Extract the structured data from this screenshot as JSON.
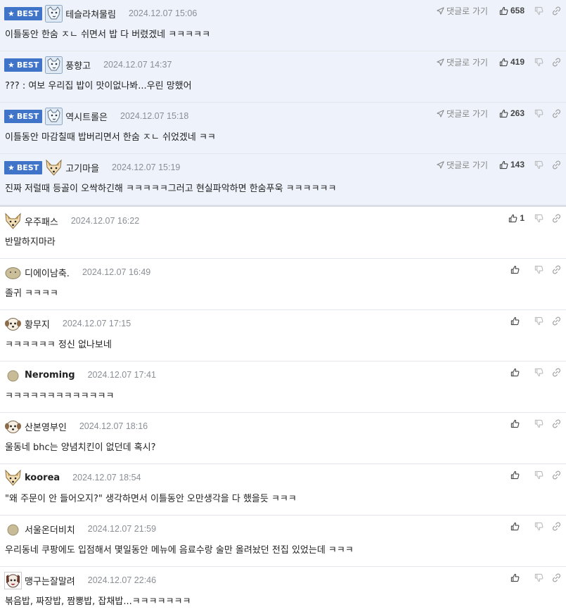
{
  "labels": {
    "best": "BEST",
    "reply": "댓글로 가기"
  },
  "colors": {
    "best_bg": "#eef3fb",
    "badge_bg": "#3f74c9",
    "date": "#8a8f96"
  },
  "comments": [
    {
      "best": true,
      "avatar": "wolf-avatar",
      "nick": "테슬라쳐물림",
      "date": "2024.12.07 15:06",
      "likes": "658",
      "text": "이틀동안 한숨 ㅈㄴ 쉬면서 밥 다 버렸겠네 ㅋㅋㅋㅋㅋ"
    },
    {
      "best": true,
      "avatar": "wolf-avatar",
      "nick": "풍향고",
      "date": "2024.12.07 14:37",
      "likes": "419",
      "text": "??? : 여보 우리집 밥이 맛이없나봐...우린 망했어"
    },
    {
      "best": true,
      "avatar": "wolf-avatar",
      "nick": "역시트롤은",
      "date": "2024.12.07 15:18",
      "likes": "263",
      "text": "이틀동안 마감칠때 밥버리면서 한숨 ㅈㄴ 쉬었겠네 ㅋㅋ"
    },
    {
      "best": true,
      "avatar": "fox-avatar",
      "nick": "고기마을",
      "date": "2024.12.07 15:19",
      "likes": "143",
      "text": "진짜 저럴때 등골이 오싹하긴해 ㅋㅋㅋㅋㅋ그러고 현실파악하면 한숨푸욱 ㅋㅋㅋㅋㅋㅋ"
    },
    {
      "best": false,
      "avatar": "fox-avatar",
      "nick": "우주패스",
      "date": "2024.12.07 16:22",
      "likes": "1",
      "text": "반말하지마라"
    },
    {
      "best": false,
      "avatar": "potato-avatar",
      "nick": "디에이남축.",
      "date": "2024.12.07 16:49",
      "likes": "",
      "text": "졸귀 ㅋㅋㅋㅋ"
    },
    {
      "best": false,
      "avatar": "puppy-avatar",
      "nick": "황무지",
      "date": "2024.12.07 17:15",
      "likes": "",
      "text": "ㅋㅋㅋㅋㅋㅋ 정신 없나보네"
    },
    {
      "best": false,
      "avatar": "dot-avatar",
      "nick": "Neroming",
      "date": "2024.12.07 17:41",
      "likes": "",
      "text": "ㅋㅋㅋㅋㅋㅋㅋㅋㅋㅋㅋㅋㅋ",
      "bold": true
    },
    {
      "best": false,
      "avatar": "puppy-avatar",
      "nick": "산본영부인",
      "date": "2024.12.07 18:16",
      "likes": "",
      "text": "울동네 bhc는 양념치킨이 없던데 혹시?"
    },
    {
      "best": false,
      "avatar": "fox-avatar",
      "nick": "koorea",
      "date": "2024.12.07 18:54",
      "likes": "",
      "text": "\"왜 주문이 안 들어오지?\" 생각하면서 이틀동안 오만생각을 다 했을듯 ㅋㅋㅋ",
      "bold": true
    },
    {
      "best": false,
      "avatar": "dot-avatar",
      "nick": "서울온더비치",
      "date": "2024.12.07 21:59",
      "likes": "",
      "text": "우리동네 쿠팡에도 입점해서 몇일동안 메뉴에 음료수랑 술만 올려놨던 전집 있었는데 ㅋㅋㅋ"
    },
    {
      "best": false,
      "avatar": "dog-avatar",
      "nick": "맹구는잘말려",
      "date": "2024.12.07 22:46",
      "likes": "",
      "text": "볶음밥, 짜장밥, 짬뽕밥, 잡채밥...ㅋㅋㅋㅋㅋㅋㅋ"
    }
  ]
}
